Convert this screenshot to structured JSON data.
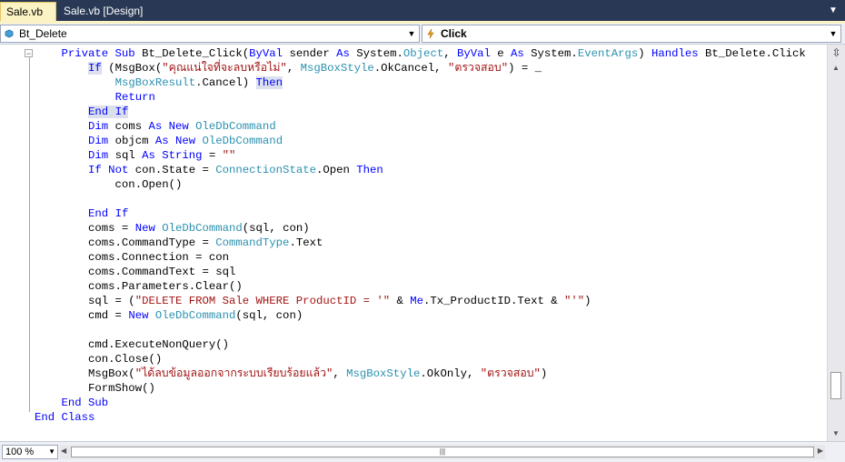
{
  "tabs": [
    {
      "label": "Sale.vb",
      "active": true
    },
    {
      "label": "Sale.vb [Design]",
      "active": false
    }
  ],
  "navigation": {
    "class_combo": "Bt_Delete",
    "method_combo": "Click"
  },
  "zoom": "100 %",
  "colors": {
    "keyword": "#0000ff",
    "type": "#2b91af",
    "string": "#a31515",
    "active_tab": "#fcf3c4",
    "background": "#293955"
  },
  "code_lines": [
    [
      [
        "kw",
        "    Private Sub "
      ],
      [
        "",
        "Bt_Delete_Click("
      ],
      [
        "kw",
        "ByVal"
      ],
      [
        "",
        " sender "
      ],
      [
        "kw",
        "As"
      ],
      [
        "",
        " System."
      ],
      [
        "ty",
        "Object"
      ],
      [
        "",
        ", "
      ],
      [
        "kw",
        "ByVal"
      ],
      [
        "",
        " e "
      ],
      [
        "kw",
        "As"
      ],
      [
        "",
        " System."
      ],
      [
        "ty",
        "EventArgs"
      ],
      [
        "",
        ") "
      ],
      [
        "kw",
        "Handles"
      ],
      [
        "",
        " Bt_Delete.Click"
      ]
    ],
    [
      [
        "",
        "        "
      ],
      [
        "kwhl",
        "If"
      ],
      [
        "",
        " (MsgBox("
      ],
      [
        "st",
        "\"คุณแน่ใจที่จะลบหรือไม่\""
      ],
      [
        "",
        ", "
      ],
      [
        "ty",
        "MsgBoxStyle"
      ],
      [
        "",
        ".OkCancel, "
      ],
      [
        "st",
        "\"ตรวจสอบ\""
      ],
      [
        "",
        ") = _"
      ]
    ],
    [
      [
        "",
        "            "
      ],
      [
        "ty",
        "MsgBoxResult"
      ],
      [
        "",
        ".Cancel) "
      ],
      [
        "kwhl",
        "Then"
      ]
    ],
    [
      [
        "",
        "            "
      ],
      [
        "kw",
        "Return"
      ]
    ],
    [
      [
        "",
        "        "
      ],
      [
        "kwhl",
        "End If"
      ]
    ],
    [
      [
        "",
        "        "
      ],
      [
        "kw",
        "Dim"
      ],
      [
        "",
        " coms "
      ],
      [
        "kw",
        "As New"
      ],
      [
        "",
        " "
      ],
      [
        "ty",
        "OleDbCommand"
      ]
    ],
    [
      [
        "",
        "        "
      ],
      [
        "kw",
        "Dim"
      ],
      [
        "",
        " objcm "
      ],
      [
        "kw",
        "As New"
      ],
      [
        "",
        " "
      ],
      [
        "ty",
        "OleDbCommand"
      ]
    ],
    [
      [
        "",
        "        "
      ],
      [
        "kw",
        "Dim"
      ],
      [
        "",
        " sql "
      ],
      [
        "kw",
        "As String"
      ],
      [
        "",
        " = "
      ],
      [
        "st",
        "\"\""
      ]
    ],
    [
      [
        "",
        "        "
      ],
      [
        "kw",
        "If Not"
      ],
      [
        "",
        " con.State = "
      ],
      [
        "ty",
        "ConnectionState"
      ],
      [
        "",
        ".Open "
      ],
      [
        "kw",
        "Then"
      ]
    ],
    [
      [
        "",
        "            con.Open()"
      ]
    ],
    [
      [
        "",
        ""
      ]
    ],
    [
      [
        "",
        "        "
      ],
      [
        "kw",
        "End If"
      ]
    ],
    [
      [
        "",
        "        coms = "
      ],
      [
        "kw",
        "New"
      ],
      [
        "",
        " "
      ],
      [
        "ty",
        "OleDbCommand"
      ],
      [
        "",
        "(sql, con)"
      ]
    ],
    [
      [
        "",
        "        coms.CommandType = "
      ],
      [
        "ty",
        "CommandType"
      ],
      [
        "",
        ".Text"
      ]
    ],
    [
      [
        "",
        "        coms.Connection = con"
      ]
    ],
    [
      [
        "",
        "        coms.CommandText = sql"
      ]
    ],
    [
      [
        "",
        "        coms.Parameters.Clear()"
      ]
    ],
    [
      [
        "",
        "        sql = ("
      ],
      [
        "st",
        "\"DELETE FROM Sale WHERE ProductID = '\""
      ],
      [
        "",
        " & "
      ],
      [
        "kw",
        "Me"
      ],
      [
        "",
        ".Tx_ProductID.Text & "
      ],
      [
        "st",
        "\"'\""
      ],
      [
        "",
        ")"
      ]
    ],
    [
      [
        "",
        "        cmd = "
      ],
      [
        "kw",
        "New"
      ],
      [
        "",
        " "
      ],
      [
        "ty",
        "OleDbCommand"
      ],
      [
        "",
        "(sql, con)"
      ]
    ],
    [
      [
        "",
        ""
      ]
    ],
    [
      [
        "",
        "        cmd.ExecuteNonQuery()"
      ]
    ],
    [
      [
        "",
        "        con.Close()"
      ]
    ],
    [
      [
        "",
        "        MsgBox("
      ],
      [
        "st",
        "\"ได้ลบข้อมูลออกจากระบบเรียบร้อยแล้ว\""
      ],
      [
        "",
        ", "
      ],
      [
        "ty",
        "MsgBoxStyle"
      ],
      [
        "",
        ".OkOnly, "
      ],
      [
        "st",
        "\"ตรวจสอบ\""
      ],
      [
        "",
        ")"
      ]
    ],
    [
      [
        "",
        "        FormShow()"
      ]
    ],
    [
      [
        "",
        "    "
      ],
      [
        "kw",
        "End Sub"
      ]
    ],
    [
      [
        "kw",
        "End Class"
      ]
    ]
  ]
}
